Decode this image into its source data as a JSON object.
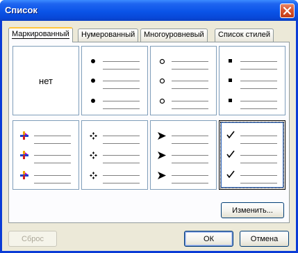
{
  "window": {
    "title": "Список",
    "close_icon": "close-icon"
  },
  "tabs": [
    {
      "label": "Маркированный",
      "active": true
    },
    {
      "label": "Нумерованный",
      "active": false
    },
    {
      "label": "Многоуровневый",
      "active": false
    },
    {
      "label": "Список стилей",
      "active": false
    }
  ],
  "gallery": {
    "none_label": "нет",
    "cells": [
      {
        "bullet": "none",
        "selected": false
      },
      {
        "bullet": "filled-circle-icon",
        "selected": false
      },
      {
        "bullet": "hollow-circle-icon",
        "selected": false
      },
      {
        "bullet": "filled-square-icon",
        "selected": false
      },
      {
        "bullet": "colored-arrow-icon",
        "selected": false
      },
      {
        "bullet": "four-diamond-icon",
        "selected": false
      },
      {
        "bullet": "arrowhead-icon",
        "selected": false
      },
      {
        "bullet": "checkmark-icon",
        "selected": true
      }
    ]
  },
  "buttons": {
    "customize": "Изменить...",
    "reset": "Сброс",
    "ok": "ОК",
    "cancel": "Отмена"
  }
}
